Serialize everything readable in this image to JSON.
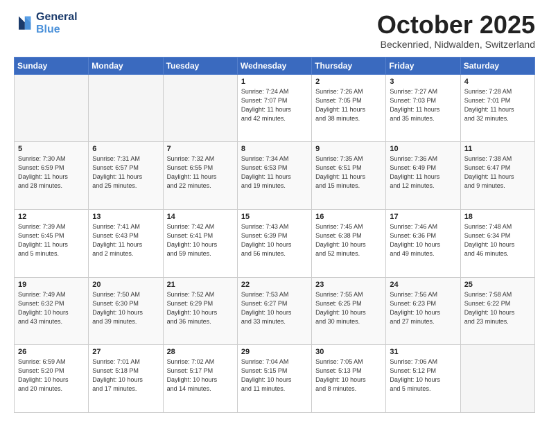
{
  "header": {
    "logo_line1": "General",
    "logo_line2": "Blue",
    "month": "October 2025",
    "location": "Beckenried, Nidwalden, Switzerland"
  },
  "days_of_week": [
    "Sunday",
    "Monday",
    "Tuesday",
    "Wednesday",
    "Thursday",
    "Friday",
    "Saturday"
  ],
  "weeks": [
    [
      {
        "day": "",
        "info": ""
      },
      {
        "day": "",
        "info": ""
      },
      {
        "day": "",
        "info": ""
      },
      {
        "day": "1",
        "info": "Sunrise: 7:24 AM\nSunset: 7:07 PM\nDaylight: 11 hours\nand 42 minutes."
      },
      {
        "day": "2",
        "info": "Sunrise: 7:26 AM\nSunset: 7:05 PM\nDaylight: 11 hours\nand 38 minutes."
      },
      {
        "day": "3",
        "info": "Sunrise: 7:27 AM\nSunset: 7:03 PM\nDaylight: 11 hours\nand 35 minutes."
      },
      {
        "day": "4",
        "info": "Sunrise: 7:28 AM\nSunset: 7:01 PM\nDaylight: 11 hours\nand 32 minutes."
      }
    ],
    [
      {
        "day": "5",
        "info": "Sunrise: 7:30 AM\nSunset: 6:59 PM\nDaylight: 11 hours\nand 28 minutes."
      },
      {
        "day": "6",
        "info": "Sunrise: 7:31 AM\nSunset: 6:57 PM\nDaylight: 11 hours\nand 25 minutes."
      },
      {
        "day": "7",
        "info": "Sunrise: 7:32 AM\nSunset: 6:55 PM\nDaylight: 11 hours\nand 22 minutes."
      },
      {
        "day": "8",
        "info": "Sunrise: 7:34 AM\nSunset: 6:53 PM\nDaylight: 11 hours\nand 19 minutes."
      },
      {
        "day": "9",
        "info": "Sunrise: 7:35 AM\nSunset: 6:51 PM\nDaylight: 11 hours\nand 15 minutes."
      },
      {
        "day": "10",
        "info": "Sunrise: 7:36 AM\nSunset: 6:49 PM\nDaylight: 11 hours\nand 12 minutes."
      },
      {
        "day": "11",
        "info": "Sunrise: 7:38 AM\nSunset: 6:47 PM\nDaylight: 11 hours\nand 9 minutes."
      }
    ],
    [
      {
        "day": "12",
        "info": "Sunrise: 7:39 AM\nSunset: 6:45 PM\nDaylight: 11 hours\nand 5 minutes."
      },
      {
        "day": "13",
        "info": "Sunrise: 7:41 AM\nSunset: 6:43 PM\nDaylight: 11 hours\nand 2 minutes."
      },
      {
        "day": "14",
        "info": "Sunrise: 7:42 AM\nSunset: 6:41 PM\nDaylight: 10 hours\nand 59 minutes."
      },
      {
        "day": "15",
        "info": "Sunrise: 7:43 AM\nSunset: 6:39 PM\nDaylight: 10 hours\nand 56 minutes."
      },
      {
        "day": "16",
        "info": "Sunrise: 7:45 AM\nSunset: 6:38 PM\nDaylight: 10 hours\nand 52 minutes."
      },
      {
        "day": "17",
        "info": "Sunrise: 7:46 AM\nSunset: 6:36 PM\nDaylight: 10 hours\nand 49 minutes."
      },
      {
        "day": "18",
        "info": "Sunrise: 7:48 AM\nSunset: 6:34 PM\nDaylight: 10 hours\nand 46 minutes."
      }
    ],
    [
      {
        "day": "19",
        "info": "Sunrise: 7:49 AM\nSunset: 6:32 PM\nDaylight: 10 hours\nand 43 minutes."
      },
      {
        "day": "20",
        "info": "Sunrise: 7:50 AM\nSunset: 6:30 PM\nDaylight: 10 hours\nand 39 minutes."
      },
      {
        "day": "21",
        "info": "Sunrise: 7:52 AM\nSunset: 6:29 PM\nDaylight: 10 hours\nand 36 minutes."
      },
      {
        "day": "22",
        "info": "Sunrise: 7:53 AM\nSunset: 6:27 PM\nDaylight: 10 hours\nand 33 minutes."
      },
      {
        "day": "23",
        "info": "Sunrise: 7:55 AM\nSunset: 6:25 PM\nDaylight: 10 hours\nand 30 minutes."
      },
      {
        "day": "24",
        "info": "Sunrise: 7:56 AM\nSunset: 6:23 PM\nDaylight: 10 hours\nand 27 minutes."
      },
      {
        "day": "25",
        "info": "Sunrise: 7:58 AM\nSunset: 6:22 PM\nDaylight: 10 hours\nand 23 minutes."
      }
    ],
    [
      {
        "day": "26",
        "info": "Sunrise: 6:59 AM\nSunset: 5:20 PM\nDaylight: 10 hours\nand 20 minutes."
      },
      {
        "day": "27",
        "info": "Sunrise: 7:01 AM\nSunset: 5:18 PM\nDaylight: 10 hours\nand 17 minutes."
      },
      {
        "day": "28",
        "info": "Sunrise: 7:02 AM\nSunset: 5:17 PM\nDaylight: 10 hours\nand 14 minutes."
      },
      {
        "day": "29",
        "info": "Sunrise: 7:04 AM\nSunset: 5:15 PM\nDaylight: 10 hours\nand 11 minutes."
      },
      {
        "day": "30",
        "info": "Sunrise: 7:05 AM\nSunset: 5:13 PM\nDaylight: 10 hours\nand 8 minutes."
      },
      {
        "day": "31",
        "info": "Sunrise: 7:06 AM\nSunset: 5:12 PM\nDaylight: 10 hours\nand 5 minutes."
      },
      {
        "day": "",
        "info": ""
      }
    ]
  ]
}
